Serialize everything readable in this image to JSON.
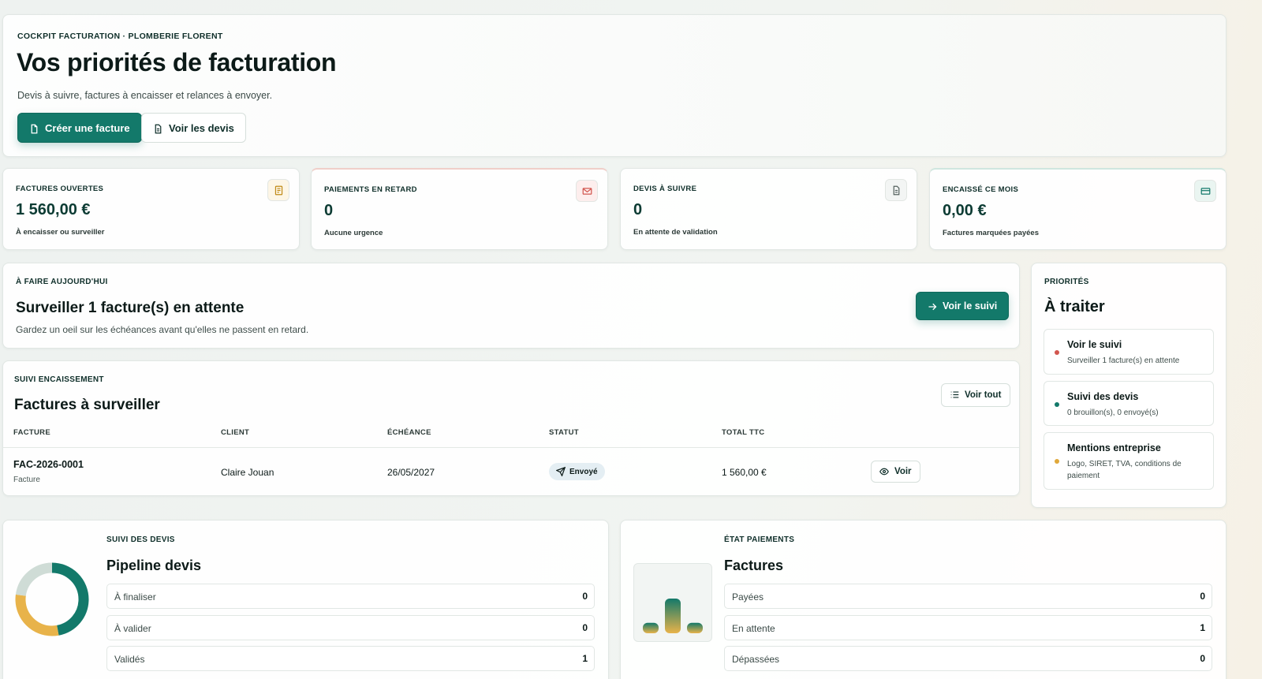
{
  "hero": {
    "eyebrow": "COCKPIT FACTURATION · PLOMBERIE FLORENT",
    "title": "Vos priorités de facturation",
    "subtitle": "Devis à suivre, factures à encaisser et relances à envoyer.",
    "primary_btn": "Créer une facture",
    "secondary_btn": "Voir les devis"
  },
  "kpis": [
    {
      "label": "FACTURES OUVERTES",
      "value": "1 560,00 €",
      "note": "À encaisser ou surveiller",
      "icon": "receipt-icon",
      "color": "#c08a17"
    },
    {
      "label": "PAIEMENTS EN RETARD",
      "value": "0",
      "note": "Aucune urgence",
      "icon": "mail-alert-icon",
      "color": "#d2564f"
    },
    {
      "label": "DEVIS À SUIVRE",
      "value": "0",
      "note": "En attente de validation",
      "icon": "document-icon",
      "color": "#55625f"
    },
    {
      "label": "ENCAISSÉ CE MOIS",
      "value": "0,00 €",
      "note": "Factures marquées payées",
      "icon": "card-icon",
      "color": "#13796a"
    }
  ],
  "today": {
    "eyebrow": "À FAIRE AUJOURD'HUI",
    "title": "Surveiller 1 facture(s) en attente",
    "subtitle": "Gardez un oeil sur les échéances avant qu'elles ne passent en retard.",
    "button": "Voir le suivi"
  },
  "priorities": {
    "eyebrow": "PRIORITÉS",
    "title": "À traiter",
    "items": [
      {
        "title": "Voir le suivi",
        "desc": "Surveiller 1 facture(s) en attente",
        "color": "#d2564f"
      },
      {
        "title": "Suivi des devis",
        "desc": "0 brouillon(s), 0 envoyé(s)",
        "color": "#13796a"
      },
      {
        "title": "Mentions entreprise",
        "desc": "Logo, SIRET, TVA, conditions de paiement",
        "color": "#e0a83a"
      }
    ]
  },
  "invoices": {
    "eyebrow": "SUIVI ENCAISSEMENT",
    "title": "Factures à surveiller",
    "view_all": "Voir tout",
    "columns": [
      "FACTURE",
      "CLIENT",
      "ÉCHÉANCE",
      "STATUT",
      "TOTAL TTC"
    ],
    "rows": [
      {
        "number": "FAC-2026-0001",
        "type": "Facture",
        "client": "Claire Jouan",
        "due": "26/05/2027",
        "status": "Envoyé",
        "total": "1 560,00 €",
        "action": "Voir"
      }
    ]
  },
  "devis": {
    "eyebrow": "SUIVI DES DEVIS",
    "title": "Pipeline devis",
    "rows": [
      {
        "label": "À finaliser",
        "value": "0"
      },
      {
        "label": "À valider",
        "value": "0"
      },
      {
        "label": "Validés",
        "value": "1"
      }
    ],
    "donut": [
      {
        "value": 0.47,
        "color": "#13796a"
      },
      {
        "value": 0.3,
        "color": "#e8b34a"
      },
      {
        "value": 0.23,
        "color": "#cfdcd6"
      }
    ]
  },
  "payments": {
    "eyebrow": "ÉTAT PAIEMENTS",
    "title": "Factures",
    "rows": [
      {
        "label": "Payées",
        "value": "0"
      },
      {
        "label": "En attente",
        "value": "1"
      },
      {
        "label": "Dépassées",
        "value": "0"
      }
    ],
    "bars": [
      0.3,
      1,
      0.3
    ]
  }
}
